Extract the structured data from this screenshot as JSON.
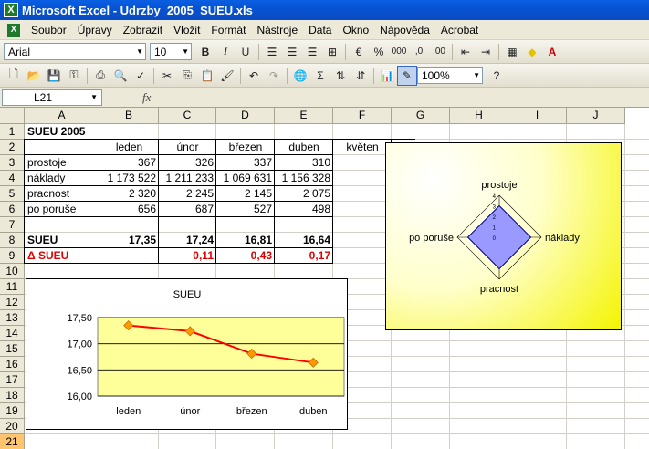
{
  "window": {
    "title": "Microsoft Excel - Udrzby_2005_SUEU.xls"
  },
  "menu": [
    "Soubor",
    "Úpravy",
    "Zobrazit",
    "Vložit",
    "Formát",
    "Nástroje",
    "Data",
    "Okno",
    "Nápověda",
    "Acrobat"
  ],
  "format_toolbar": {
    "font": "Arial",
    "size": "10",
    "bold": "B",
    "italic": "I",
    "underline": "U",
    "percent": "%",
    "thousands": "000",
    "dec_inc": ",0",
    "dec_dec": ",00"
  },
  "standard_toolbar": {
    "zoom": "100%",
    "sum": "Σ",
    "help": "?"
  },
  "formula_bar": {
    "name_box": "L21",
    "fx": "fx",
    "content": ""
  },
  "grid": {
    "columns": [
      "A",
      "B",
      "C",
      "D",
      "E",
      "F",
      "G",
      "H",
      "I",
      "J"
    ],
    "rows": [
      "1",
      "2",
      "3",
      "4",
      "5",
      "6",
      "7",
      "8",
      "9",
      "10",
      "11",
      "12",
      "13",
      "14",
      "15",
      "16",
      "17",
      "18",
      "19",
      "20",
      "21"
    ],
    "selected_row": "21",
    "cells": {
      "A1": "SUEU 2005",
      "B2": "leden",
      "C2": "únor",
      "D2": "březen",
      "E2": "duben",
      "F2": "květen",
      "A3": "prostoje",
      "B3": "367",
      "C3": "326",
      "D3": "337",
      "E3": "310",
      "A4": "náklady",
      "B4": "1 173 522",
      "C4": "1 211 233",
      "D4": "1 069 631",
      "E4": "1 156 328",
      "A5": "pracnost",
      "B5": "2 320",
      "C5": "2 245",
      "D5": "2 145",
      "E5": "2 075",
      "A6": "po poruše",
      "B6": "656",
      "C6": "687",
      "D6": "527",
      "E6": "498",
      "A8": "SUEU",
      "B8": "17,35",
      "C8": "17,24",
      "D8": "16,81",
      "E8": "16,64",
      "A9": "Δ SUEU",
      "C9": "0,11",
      "D9": "0,43",
      "E9": "0,17"
    }
  },
  "chart_data": [
    {
      "type": "line",
      "title": "SUEU",
      "categories": [
        "leden",
        "únor",
        "březen",
        "duben"
      ],
      "series": [
        {
          "values": [
            17.35,
            17.24,
            16.81,
            16.64
          ],
          "color": "#ff0000",
          "marker_color": "#ff9900"
        }
      ],
      "ylim": [
        16.0,
        17.5
      ],
      "yticks": [
        "16,00",
        "16,50",
        "17,00",
        "17,50"
      ],
      "plot_bg": "#ffff99",
      "grid": true
    },
    {
      "type": "radar",
      "axes": [
        "prostoje",
        "náklady",
        "pracnost",
        "po poruše"
      ],
      "series": [
        {
          "values": [
            3,
            3,
            3,
            3
          ],
          "fill": "#9999ff"
        }
      ],
      "rlim": [
        0,
        4
      ],
      "rticks": [
        "0",
        "1",
        "2",
        "3",
        "4"
      ],
      "background": "#ffffcc"
    }
  ],
  "colors": {
    "accent": "#0a5fe3",
    "toolbar": "#ece9d8",
    "red": "#e00000"
  }
}
